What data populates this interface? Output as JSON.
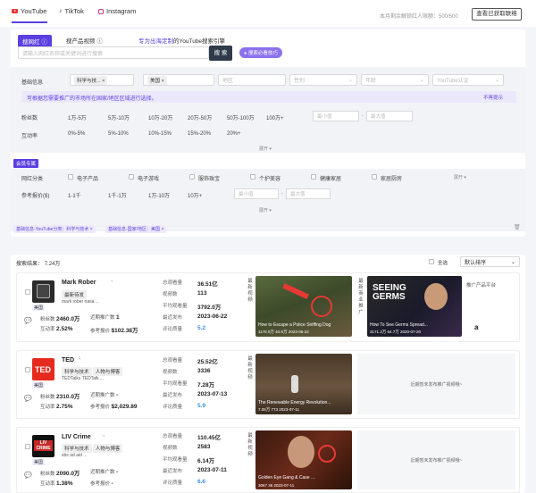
{
  "platform_tabs": [
    "YouTube",
    "TikTok",
    "Instagram"
  ],
  "quota": "本月剩余解锁红人限额：500/500",
  "view_unlocked": "查看已获取联络",
  "search": {
    "tab_active": "搜网红",
    "tab_product": "搜产品视频",
    "slogan_highlight": "专为出海定制",
    "slogan_rest": "的YouTube搜索引擎",
    "placeholder": "请输入网红名称或关键词进行搜索",
    "button": "搜 索",
    "pill": "搜索必看技巧"
  },
  "basic": {
    "label": "基础信息",
    "lang_tag": "科学与技...",
    "country_tag": "美国",
    "region": "地区",
    "gender": "性别",
    "age": "年龄",
    "yt_cert": "YouTube认证",
    "note": "可根据您需要推广的市场所在国家/地区区域进行选择。",
    "note_close": "不再提示"
  },
  "fans": {
    "label": "粉丝数",
    "opts": [
      "1万-5万",
      "5万-10万",
      "10万-20万",
      "20万-50万",
      "50万-100万",
      "100万+"
    ],
    "min": "最小值",
    "max": "最大值"
  },
  "engage": {
    "label": "互动率",
    "opts": [
      "0%-5%",
      "5%-10%",
      "10%-15%",
      "15%-20%",
      "20%+"
    ],
    "expand": "展开"
  },
  "member": {
    "tag": "会员专属",
    "cat_label": "网红分类",
    "cats": [
      "电子产品",
      "电子游戏",
      "服饰珠宝",
      "个护美容",
      "健康家居",
      "家居厨房"
    ],
    "expand": "展开",
    "price_label": "参考报价($)",
    "price_opts": [
      "1-1千",
      "1千-1万",
      "1万-10万",
      "10万+"
    ],
    "min": "最小值",
    "max": "最大值",
    "expand2": "展开"
  },
  "chips": [
    "基础信息-YouTube分类：科学与技术",
    "基础信息-国家/地区：美国"
  ],
  "results": {
    "title": "搜索结果",
    "count": "7.24万",
    "select_all": "全选",
    "sort": "默认排序"
  },
  "cards": [
    {
      "name": "Mark Rober",
      "tag1": "最新待发",
      "tag2": "",
      "sub2": "mark rober   nasa   ...",
      "flag": "美国",
      "fans_l": "粉丝数",
      "fans_v": "2460.0万",
      "recent_l": "近期推广数",
      "recent_v": "1",
      "eng_l": "互动率",
      "eng_v": "2.52%",
      "price_l": "参考报价",
      "price_v": "$102.38万",
      "s1_l": "总观看量",
      "s1_v": "36.51亿",
      "s2_l": "视频数",
      "s2_v": "113",
      "s3_l": "平均观看量",
      "s3_v": "3792.0万",
      "s4_l": "最近发布",
      "s4_v": "2023-06-22",
      "s5_l": "评论质量",
      "s5_v": "5.2",
      "vlabel1": "最新视频",
      "vlabel2": "最新商业推广",
      "v1_cap": "How to Escape a Police Sniffing Dog",
      "v1_meta": "1178.0万  40.9万  2023-06-22",
      "v2_cap": "How To See Germs Spread...",
      "v2_meta": "3171.3万  64.7万  2020-07-20",
      "v2_text": "SEEING GERMS",
      "promo": "推广产品平台",
      "promo_logo": "a"
    },
    {
      "name": "TED",
      "tag1": "科学与技术",
      "tag2": "人物与博客",
      "sub2": "TEDTalks   TEDTalk   ...",
      "flag": "美国",
      "fans_l": "粉丝数",
      "fans_v": "2310.0万",
      "recent_l": "近期推广数",
      "recent_v": "-",
      "eng_l": "互动率",
      "eng_v": "2.75%",
      "price_l": "参考报价",
      "price_v": "$2,029.89",
      "s1_l": "总观看量",
      "s1_v": "25.52亿",
      "s2_l": "视频数",
      "s2_v": "3336",
      "s3_l": "平均观看量",
      "s3_v": "7.28万",
      "s4_l": "最近发布",
      "s4_v": "2023-07-13",
      "s5_l": "评论质量",
      "s5_v": "5.9",
      "vlabel1": "最新视频",
      "v1_cap": "The Renewable Energy Revolution...",
      "v1_meta": "7.06万   773   2023-07-11",
      "empty": "近期暂未发布推广视频哦~"
    },
    {
      "name": "LIV Crime",
      "tag1": "科学与技术",
      "tag2": "人物与博客",
      "sub2": "sbs ad aid   ...",
      "flag": "美国",
      "fans_l": "粉丝数",
      "fans_v": "2090.0万",
      "recent_l": "近期推广数",
      "recent_v": "-",
      "eng_l": "互动率",
      "eng_v": "1.38%",
      "price_l": "参考报价",
      "price_v": "-",
      "s1_l": "总观看量",
      "s1_v": "110.45亿",
      "s2_l": "视频数",
      "s2_v": "2583",
      "s3_l": "平均观看量",
      "s3_v": "6.14万",
      "s4_l": "最近发布",
      "s4_v": "2023-07-11",
      "s5_l": "评论质量",
      "s5_v": "6.6",
      "vlabel1": "最新视频",
      "v1_cap": "Golden Eye Gang & Case &#8230;",
      "v1_meta": "3067     36    2023-07-11",
      "empty": "近期暂未发布推广视频哦~",
      "avatar_text": "LIV CRIME"
    }
  ]
}
